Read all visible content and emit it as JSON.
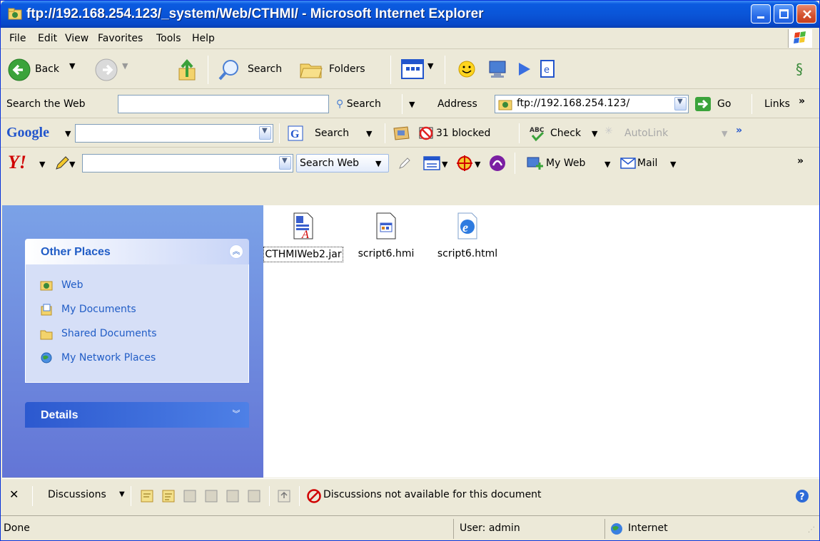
{
  "window": {
    "title": "ftp://192.168.254.123/_system/Web/CTHMI/ - Microsoft Internet Explorer"
  },
  "menu": [
    "File",
    "Edit",
    "View",
    "Favorites",
    "Tools",
    "Help"
  ],
  "std_toolbar": {
    "back": "Back",
    "search": "Search",
    "folders": "Folders"
  },
  "addr_toolbar": {
    "search_web_label": "Search the Web",
    "search_btn": "Search",
    "address_label": "Address",
    "address_value": "ftp://192.168.254.123/",
    "go": "Go",
    "links": "Links"
  },
  "google_toolbar": {
    "brand": "Google",
    "search": "Search",
    "blocked": "31 blocked",
    "check": "Check",
    "autolink": "AutoLink"
  },
  "yahoo_toolbar": {
    "brand": "Y!",
    "search_web": "Search Web",
    "my_web": "My Web",
    "mail": "Mail"
  },
  "sidebar": {
    "other_places": {
      "title": "Other Places",
      "items": [
        "Web",
        "My Documents",
        "Shared Documents",
        "My Network Places"
      ]
    },
    "details": {
      "title": "Details"
    }
  },
  "files": [
    "CTHMIWeb2.jar",
    "script6.hmi",
    "script6.html"
  ],
  "discussions": {
    "label": "Discussions",
    "message": "Discussions not available for this document"
  },
  "status": {
    "text": "Done",
    "user": "User: admin",
    "zone": "Internet"
  }
}
